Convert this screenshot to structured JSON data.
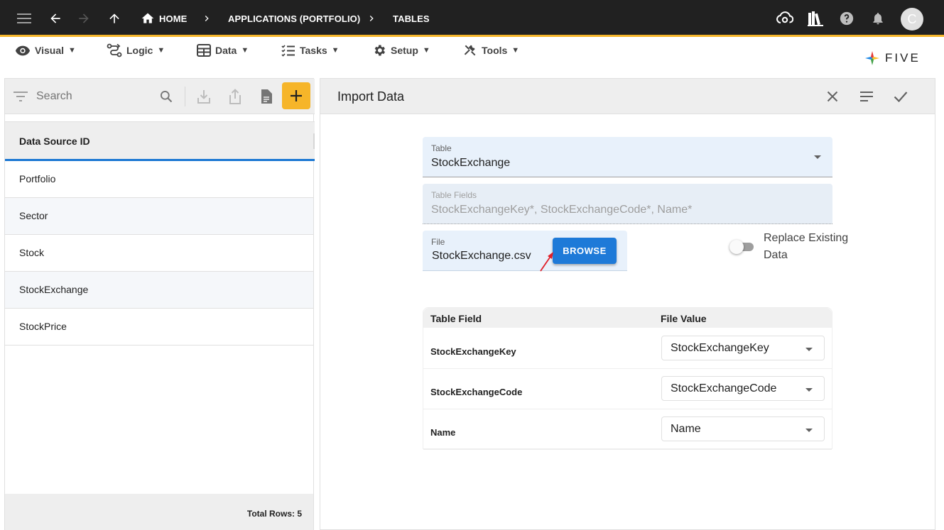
{
  "breadcrumbs": {
    "home": "HOME",
    "applications": "APPLICATIONS (PORTFOLIO)",
    "tables": "TABLES"
  },
  "avatar_letter": "C",
  "menu": [
    {
      "label": "Visual",
      "icon": "eye-icon"
    },
    {
      "label": "Logic",
      "icon": "logic-icon"
    },
    {
      "label": "Data",
      "icon": "table-icon"
    },
    {
      "label": "Tasks",
      "icon": "checklist-icon"
    },
    {
      "label": "Setup",
      "icon": "gear-icon"
    },
    {
      "label": "Tools",
      "icon": "tools-icon"
    }
  ],
  "menu_caret": "▼",
  "logo_text": "FIVE",
  "search": {
    "placeholder": "Search"
  },
  "list": {
    "header": "Data Source ID",
    "rows": [
      "Portfolio",
      "Sector",
      "Stock",
      "StockExchange",
      "StockPrice"
    ],
    "footer": "Total Rows: 5"
  },
  "form": {
    "title": "Import Data",
    "table": {
      "label": "Table",
      "value": "StockExchange"
    },
    "table_fields": {
      "label": "Table Fields",
      "value": "StockExchangeKey*, StockExchangeCode*, Name*"
    },
    "file": {
      "label": "File",
      "value": "StockExchange.csv",
      "button": "BROWSE"
    },
    "replace_existing": {
      "label": "Replace Existing Data",
      "checked": false
    },
    "mapping": {
      "col_field": "Table Field",
      "col_value": "File Value",
      "rows": [
        {
          "field": "StockExchangeKey",
          "value": "StockExchangeKey"
        },
        {
          "field": "StockExchangeCode",
          "value": "StockExchangeCode"
        },
        {
          "field": "Name",
          "value": "Name"
        }
      ]
    }
  },
  "colors": {
    "appbar": "#212121",
    "accent": "#f6b529",
    "primary": "#1e7ad8",
    "arrow_annotation": "#e0202a"
  }
}
